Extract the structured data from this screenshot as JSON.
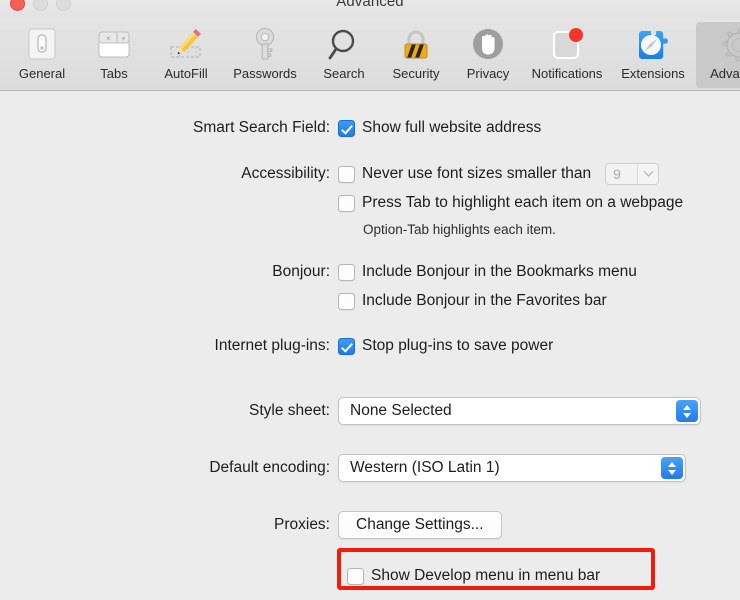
{
  "window": {
    "title": "Advanced",
    "traffic_lights": [
      {
        "name": "close",
        "color": "#f75f56"
      },
      {
        "name": "minimize",
        "color": "#dcdcdc"
      },
      {
        "name": "zoom",
        "color": "#dcdcdc"
      }
    ]
  },
  "toolbar": {
    "selected": "Advanced",
    "tabs": [
      {
        "label": "General",
        "icon": "general-icon",
        "selected": false
      },
      {
        "label": "Tabs",
        "icon": "tabs-icon",
        "selected": false
      },
      {
        "label": "AutoFill",
        "icon": "autofill-icon",
        "selected": false
      },
      {
        "label": "Passwords",
        "icon": "passwords-key-icon",
        "selected": false
      },
      {
        "label": "Search",
        "icon": "search-magnifier-icon",
        "selected": false
      },
      {
        "label": "Security",
        "icon": "security-lock-icon",
        "selected": false
      },
      {
        "label": "Privacy",
        "icon": "privacy-hand-icon",
        "selected": false
      },
      {
        "label": "Notifications",
        "icon": "notifications-badge-icon",
        "selected": false
      },
      {
        "label": "Extensions",
        "icon": "extensions-puzzle-icon",
        "selected": false
      },
      {
        "label": "Advanced",
        "icon": "advanced-gear-icon",
        "selected": true
      }
    ]
  },
  "settings": {
    "smart_search_field": {
      "label": "Smart Search Field:",
      "checkbox_label": "Show full website address",
      "checked": true
    },
    "accessibility": {
      "label": "Accessibility:",
      "font_size_label": "Never use font sizes smaller than",
      "font_size_checked": false,
      "font_size_value": "9",
      "press_tab_label": "Press Tab to highlight each item on a webpage",
      "press_tab_checked": false,
      "hint": "Option-Tab highlights each item."
    },
    "bonjour": {
      "label": "Bonjour:",
      "bookmarks_label": "Include Bonjour in the Bookmarks menu",
      "bookmarks_checked": false,
      "favorites_label": "Include Bonjour in the Favorites bar",
      "favorites_checked": false
    },
    "internet_plugins": {
      "label": "Internet plug-ins:",
      "checkbox_label": "Stop plug-ins to save power",
      "checked": true
    },
    "style_sheet": {
      "label": "Style sheet:",
      "value": "None Selected"
    },
    "default_encoding": {
      "label": "Default encoding:",
      "value": "Western (ISO Latin 1)"
    },
    "proxies": {
      "label": "Proxies:",
      "button_label": "Change Settings..."
    },
    "develop_menu": {
      "checkbox_label": "Show Develop menu in menu bar",
      "checked": false,
      "highlight_color": "#f01c0c"
    }
  }
}
